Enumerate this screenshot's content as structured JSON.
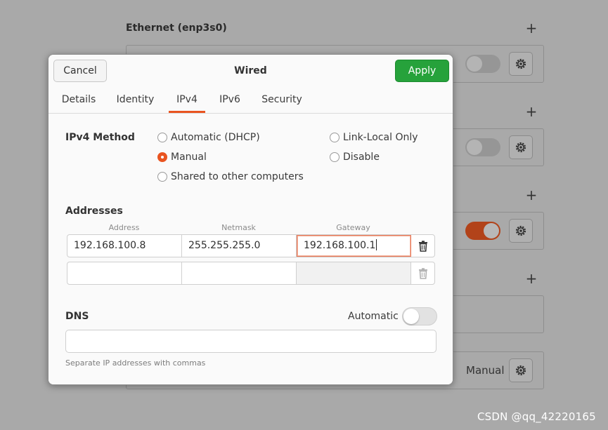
{
  "background": {
    "section_title": "Ethernet (enp3s0)",
    "manual_label": "Manual",
    "watermark": "CSDN @qq_42220165"
  },
  "dialog": {
    "title": "Wired",
    "cancel_label": "Cancel",
    "apply_label": "Apply",
    "tabs": [
      {
        "label": "Details",
        "active": false
      },
      {
        "label": "Identity",
        "active": false
      },
      {
        "label": "IPv4",
        "active": true
      },
      {
        "label": "IPv6",
        "active": false
      },
      {
        "label": "Security",
        "active": false
      }
    ],
    "ipv4_method": {
      "label": "IPv4 Method",
      "options": [
        {
          "label": "Automatic (DHCP)",
          "checked": false
        },
        {
          "label": "Manual",
          "checked": true
        },
        {
          "label": "Shared to other computers",
          "checked": false
        },
        {
          "label": "Link-Local Only",
          "checked": false
        },
        {
          "label": "Disable",
          "checked": false
        }
      ]
    },
    "addresses": {
      "label": "Addresses",
      "columns": [
        "Address",
        "Netmask",
        "Gateway"
      ],
      "rows": [
        {
          "address": "192.168.100.8",
          "netmask": "255.255.255.0",
          "gateway": "192.168.100.1"
        },
        {
          "address": "",
          "netmask": "",
          "gateway": ""
        }
      ]
    },
    "dns": {
      "label": "DNS",
      "automatic_label": "Automatic",
      "automatic_on": false,
      "value": "",
      "hint": "Separate IP addresses with commas"
    }
  },
  "colors": {
    "accent": "#e95420",
    "apply_green": "#26a23b",
    "toggle_on_dimmed": "#b2431a"
  }
}
